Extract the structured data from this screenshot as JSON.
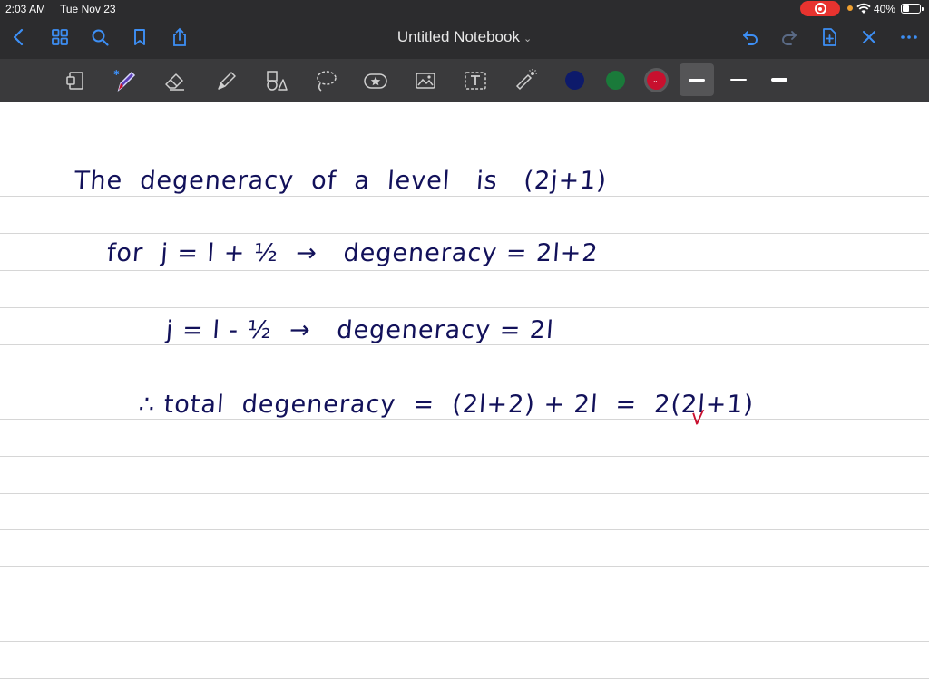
{
  "status_bar": {
    "time": "2:03 AM",
    "date": "Tue Nov 23",
    "battery": "40%",
    "battery_level": 0.4
  },
  "nav": {
    "title": "Untitled Notebook",
    "icons": [
      "back-icon",
      "grid-icon",
      "search-icon",
      "bookmark-icon",
      "share-icon",
      "undo-icon",
      "redo-icon",
      "add-page-icon",
      "close-icon",
      "more-icon"
    ]
  },
  "toolbar": {
    "tools": [
      "page-scan-icon",
      "pen-icon",
      "eraser-icon",
      "highlighter-icon",
      "shapes-icon",
      "lasso-icon",
      "sticker-icon",
      "image-icon",
      "text-icon",
      "laser-pointer-icon"
    ],
    "colors": [
      "#0d1a6b",
      "#1a7a3a",
      "#c8102e"
    ],
    "selected_color": "#c8102e",
    "strokes": [
      "thick",
      "thin",
      "medium"
    ]
  },
  "notes": {
    "line1": "The  degeneracy  of  a  level   is   (2j+1)",
    "line2": "for  j = l + ½  →   degeneracy = 2l+2",
    "line3": "j = l - ½  →   degeneracy = 2l",
    "line4": "∴ total  degeneracy  =  (2l+2) + 2l  =  2(2l+1)",
    "mark": "⩗"
  }
}
